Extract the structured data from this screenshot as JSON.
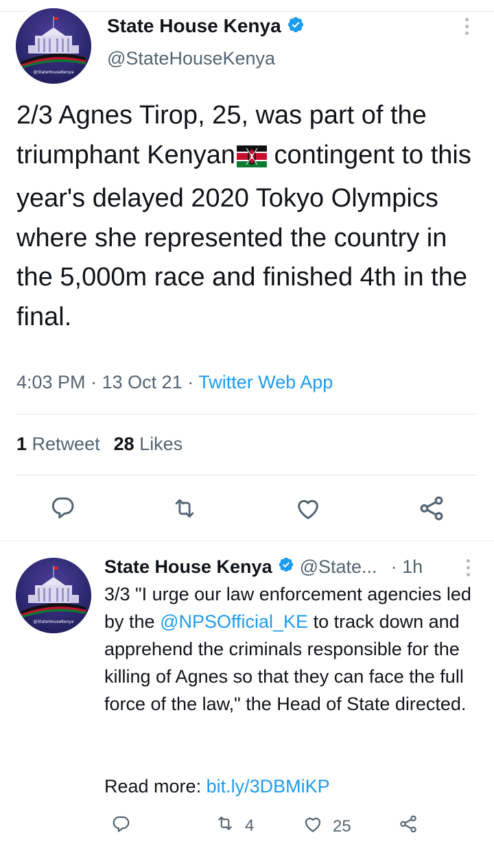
{
  "main_tweet": {
    "display_name": "State House Kenya",
    "handle": "@StateHouseKenya",
    "avatar_caption": "@StateHouseKenya",
    "text": "2/3 Agnes Tirop, 25, was part of the triumphant Kenyan",
    "text_after_flag": " contingent to this year's delayed 2020 Tokyo Olympics where she represented the country in the 5,000m race and finished 4th in the final.",
    "time": "4:03 PM",
    "date": "13 Oct 21",
    "separator": "·",
    "source": "Twitter Web App",
    "retweet_count": "1",
    "retweet_label": "Retweet",
    "like_count": "28",
    "like_label": "Likes"
  },
  "reply_tweet": {
    "display_name": "State House Kenya",
    "handle": "@State...",
    "separator": "·",
    "time": "1h",
    "text_part1": "3/3 \"I urge our law enforcement agencies led by the ",
    "mention": "@NPSOfficial_KE",
    "text_part2": " to track down and apprehend the criminals responsible for the killing of Agnes so that they can face the full force of the law,\" the Head of State directed.",
    "read_more_label": "Read more: ",
    "read_more_link": "bit.ly/3DBMiKP",
    "retweet_count": "4",
    "like_count": "25"
  },
  "icons": {
    "verified": "verified-badge-icon",
    "more": "more-vertical-icon",
    "reply": "reply-icon",
    "retweet": "retweet-icon",
    "like": "heart-icon",
    "share": "share-icon",
    "flag": "kenya-flag-emoji"
  },
  "colors": {
    "accent": "#1d9bf0",
    "text_primary": "#0f1419",
    "text_secondary": "#536471",
    "divider": "#e1e6ea"
  }
}
